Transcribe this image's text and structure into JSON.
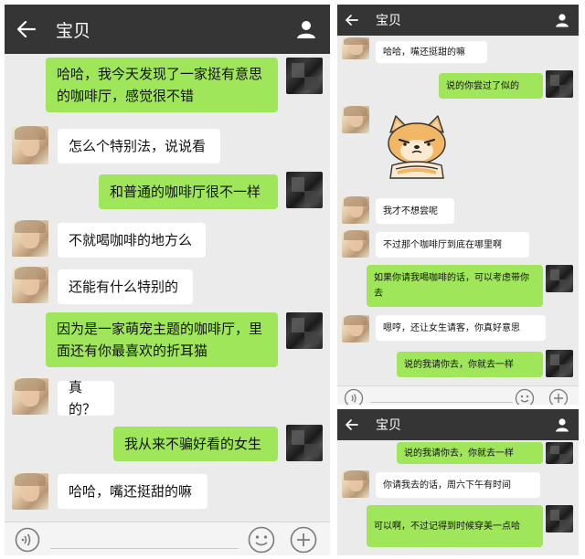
{
  "header": {
    "title": "宝贝"
  },
  "left_messages": [
    "哈哈，我今天发现了一家挺有意思的咖啡厅，感觉很不错",
    "怎么个特别法，说说看",
    "和普通的咖啡厅很不一样",
    "不就喝咖啡的地方么",
    "还能有什么特别的",
    "因为是一家萌宠主题的咖啡厅，里面还有你最喜欢的折耳猫",
    "真的？",
    "我从来不骗好看的女生",
    "哈哈，嘴还挺甜的嘛"
  ],
  "right_top_messages": [
    "哈哈，嘴还挺甜的嘛",
    "说的你尝过了似的",
    "我才不想尝呢",
    "不过那个咖啡厅到底在哪里啊",
    "如果你请我喝咖啡的话，可以考虑带你去",
    "嗯哼，还让女生请客，你真好意思",
    "说的我请你去，你就去一样"
  ],
  "right_bottom_messages": [
    "说的我请你去，你就去一样",
    "你请我去的话，周六下午有时间",
    "可以啊，不过记得到时候穿美一点哈"
  ],
  "icons": {
    "back": "back-arrow-icon",
    "profile": "profile-icon",
    "voice": "voice-icon",
    "emoji": "emoji-icon",
    "plus": "plus-icon",
    "sticker": "shiba-inu-sticker"
  },
  "colors": {
    "header": "#353535",
    "chat_bg": "#ebebeb",
    "green_bubble": "#9fe65a",
    "white_bubble": "#ffffff"
  }
}
